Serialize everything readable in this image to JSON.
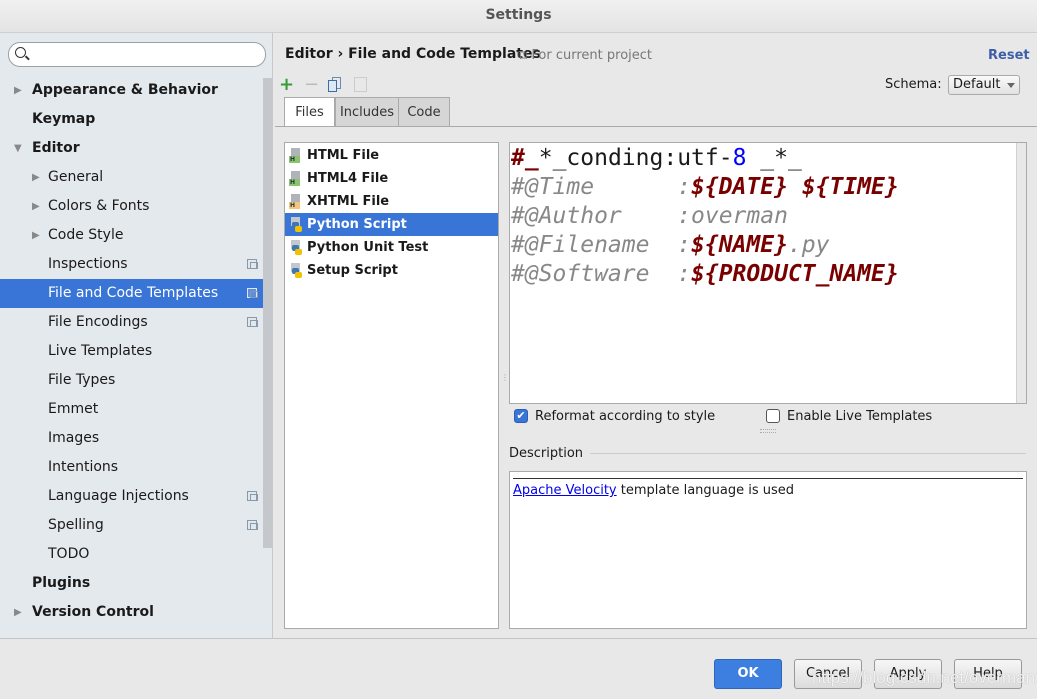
{
  "window": {
    "title": "Settings"
  },
  "sidebar": {
    "search_placeholder": "",
    "items": [
      {
        "label": "Appearance & Behavior",
        "level": 0,
        "bold": true,
        "arrow": "right"
      },
      {
        "label": "Keymap",
        "level": 0,
        "bold": true
      },
      {
        "label": "Editor",
        "level": 0,
        "bold": true,
        "arrow": "down"
      },
      {
        "label": "General",
        "level": 1,
        "arrow": "right"
      },
      {
        "label": "Colors & Fonts",
        "level": 1,
        "arrow": "right"
      },
      {
        "label": "Code Style",
        "level": 1,
        "arrow": "right"
      },
      {
        "label": "Inspections",
        "level": 1,
        "project": true
      },
      {
        "label": "File and Code Templates",
        "level": 1,
        "project": true,
        "selected": true
      },
      {
        "label": "File Encodings",
        "level": 1,
        "project": true
      },
      {
        "label": "Live Templates",
        "level": 1
      },
      {
        "label": "File Types",
        "level": 1
      },
      {
        "label": "Emmet",
        "level": 1
      },
      {
        "label": "Images",
        "level": 1
      },
      {
        "label": "Intentions",
        "level": 1
      },
      {
        "label": "Language Injections",
        "level": 1,
        "project": true
      },
      {
        "label": "Spelling",
        "level": 1,
        "project": true
      },
      {
        "label": "TODO",
        "level": 1
      },
      {
        "label": "Plugins",
        "level": 0,
        "bold": true
      },
      {
        "label": "Version Control",
        "level": 0,
        "bold": true,
        "arrow": "right"
      }
    ]
  },
  "header": {
    "breadcrumb": "Editor › File and Code Templates",
    "scope": "For current project",
    "reset": "Reset",
    "schema_label": "Schema:",
    "schema_value": "Default"
  },
  "toolbar": {
    "icons": [
      "add-icon",
      "remove-icon",
      "copy-icon",
      "reset-icon"
    ]
  },
  "tabs": [
    {
      "label": "Files",
      "active": true
    },
    {
      "label": "Includes"
    },
    {
      "label": "Code"
    }
  ],
  "files": [
    {
      "label": "HTML File",
      "icon": "html",
      "badge": "H",
      "color": "#8cc36e"
    },
    {
      "label": "HTML4 File",
      "icon": "html",
      "badge": "H",
      "color": "#8cc36e"
    },
    {
      "label": "XHTML File",
      "icon": "html",
      "badge": "H",
      "color": "#f5c67a"
    },
    {
      "label": "Python Script",
      "icon": "python",
      "selected": true
    },
    {
      "label": "Python Unit Test",
      "icon": "python"
    },
    {
      "label": "Setup Script",
      "icon": "python"
    }
  ],
  "editor": {
    "lines": [
      [
        {
          "t": "#",
          "c": "kw"
        },
        {
          "t": "_",
          "c": "kw"
        },
        {
          "t": "*_conding:utf-",
          "c": ""
        },
        {
          "t": "8",
          "c": "num"
        },
        {
          "t": " _*_",
          "c": ""
        }
      ],
      [
        {
          "t": "#@Time      :",
          "c": "cm"
        },
        {
          "t": "${DATE}",
          "c": "var"
        },
        {
          "t": " ",
          "c": "cm"
        },
        {
          "t": "${TIME}",
          "c": "var"
        }
      ],
      [
        {
          "t": "#@Author    :overman",
          "c": "cm"
        }
      ],
      [
        {
          "t": "#@Filename  :",
          "c": "cm"
        },
        {
          "t": "${NAME}",
          "c": "var"
        },
        {
          "t": ".py",
          "c": "cm"
        }
      ],
      [
        {
          "t": "#@Software  :",
          "c": "cm"
        },
        {
          "t": "${PRODUCT_NAME}",
          "c": "var"
        }
      ]
    ]
  },
  "options": {
    "reformat": {
      "label": "Reformat according to style",
      "checked": true
    },
    "live_templates": {
      "label": "Enable Live Templates",
      "checked": false
    }
  },
  "description": {
    "label": "Description",
    "link": "Apache Velocity",
    "text": " template language is used"
  },
  "buttons": {
    "ok": "OK",
    "cancel": "Cancel",
    "apply": "Apply",
    "help": "Help"
  },
  "watermark": "https://blog.csdn.net/overman1",
  "colors": {
    "accent": "#3875d7",
    "ok_button": "#3d7fe0",
    "link": "#0000ee",
    "template_var": "#7a0000"
  }
}
